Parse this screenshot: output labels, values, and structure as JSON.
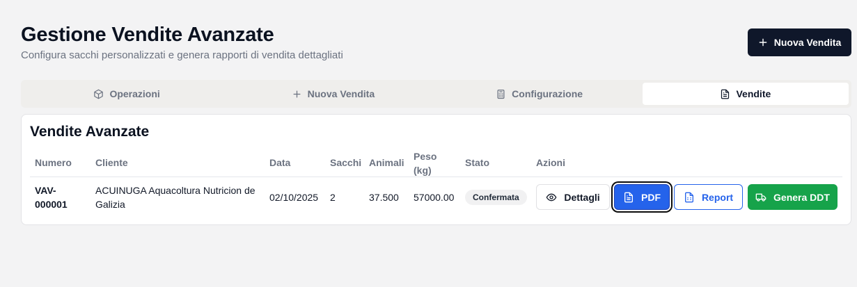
{
  "header": {
    "title": "Gestione Vendite Avanzate",
    "subtitle": "Configura sacchi personalizzati e genera rapporti di vendita dettagliati",
    "new_sale_button": "Nuova Vendita"
  },
  "tabs": [
    {
      "label": "Operazioni",
      "icon": "box-icon",
      "active": false
    },
    {
      "label": "Nuova Vendita",
      "icon": "plus-icon",
      "active": false
    },
    {
      "label": "Configurazione",
      "icon": "calculator-icon",
      "active": false
    },
    {
      "label": "Vendite",
      "icon": "file-text-icon",
      "active": true
    }
  ],
  "sales": {
    "title": "Vendite Avanzate",
    "columns": {
      "number": "Numero",
      "client": "Cliente",
      "date": "Data",
      "bags": "Sacchi",
      "animals": "Animali",
      "weight_line1": "Peso",
      "weight_line2": "(kg)",
      "status": "Stato",
      "actions": "Azioni"
    },
    "rows": [
      {
        "number_line1": "VAV-",
        "number_line2": "000001",
        "client_line1": "ACUINUGA Aquacoltura Nutricion de",
        "client_line2": "Galizia",
        "date": "02/10/2025",
        "bags": "2",
        "animals": "37.500",
        "weight": "57000.00",
        "status": "Confermata"
      }
    ],
    "actions": {
      "details": "Dettagli",
      "pdf": "PDF",
      "report": "Report",
      "ddt": "Genera DDT"
    }
  },
  "colors": {
    "primary_dark": "#0f172a",
    "pdf_blue": "#2563eb",
    "ddt_green": "#16a34a"
  }
}
